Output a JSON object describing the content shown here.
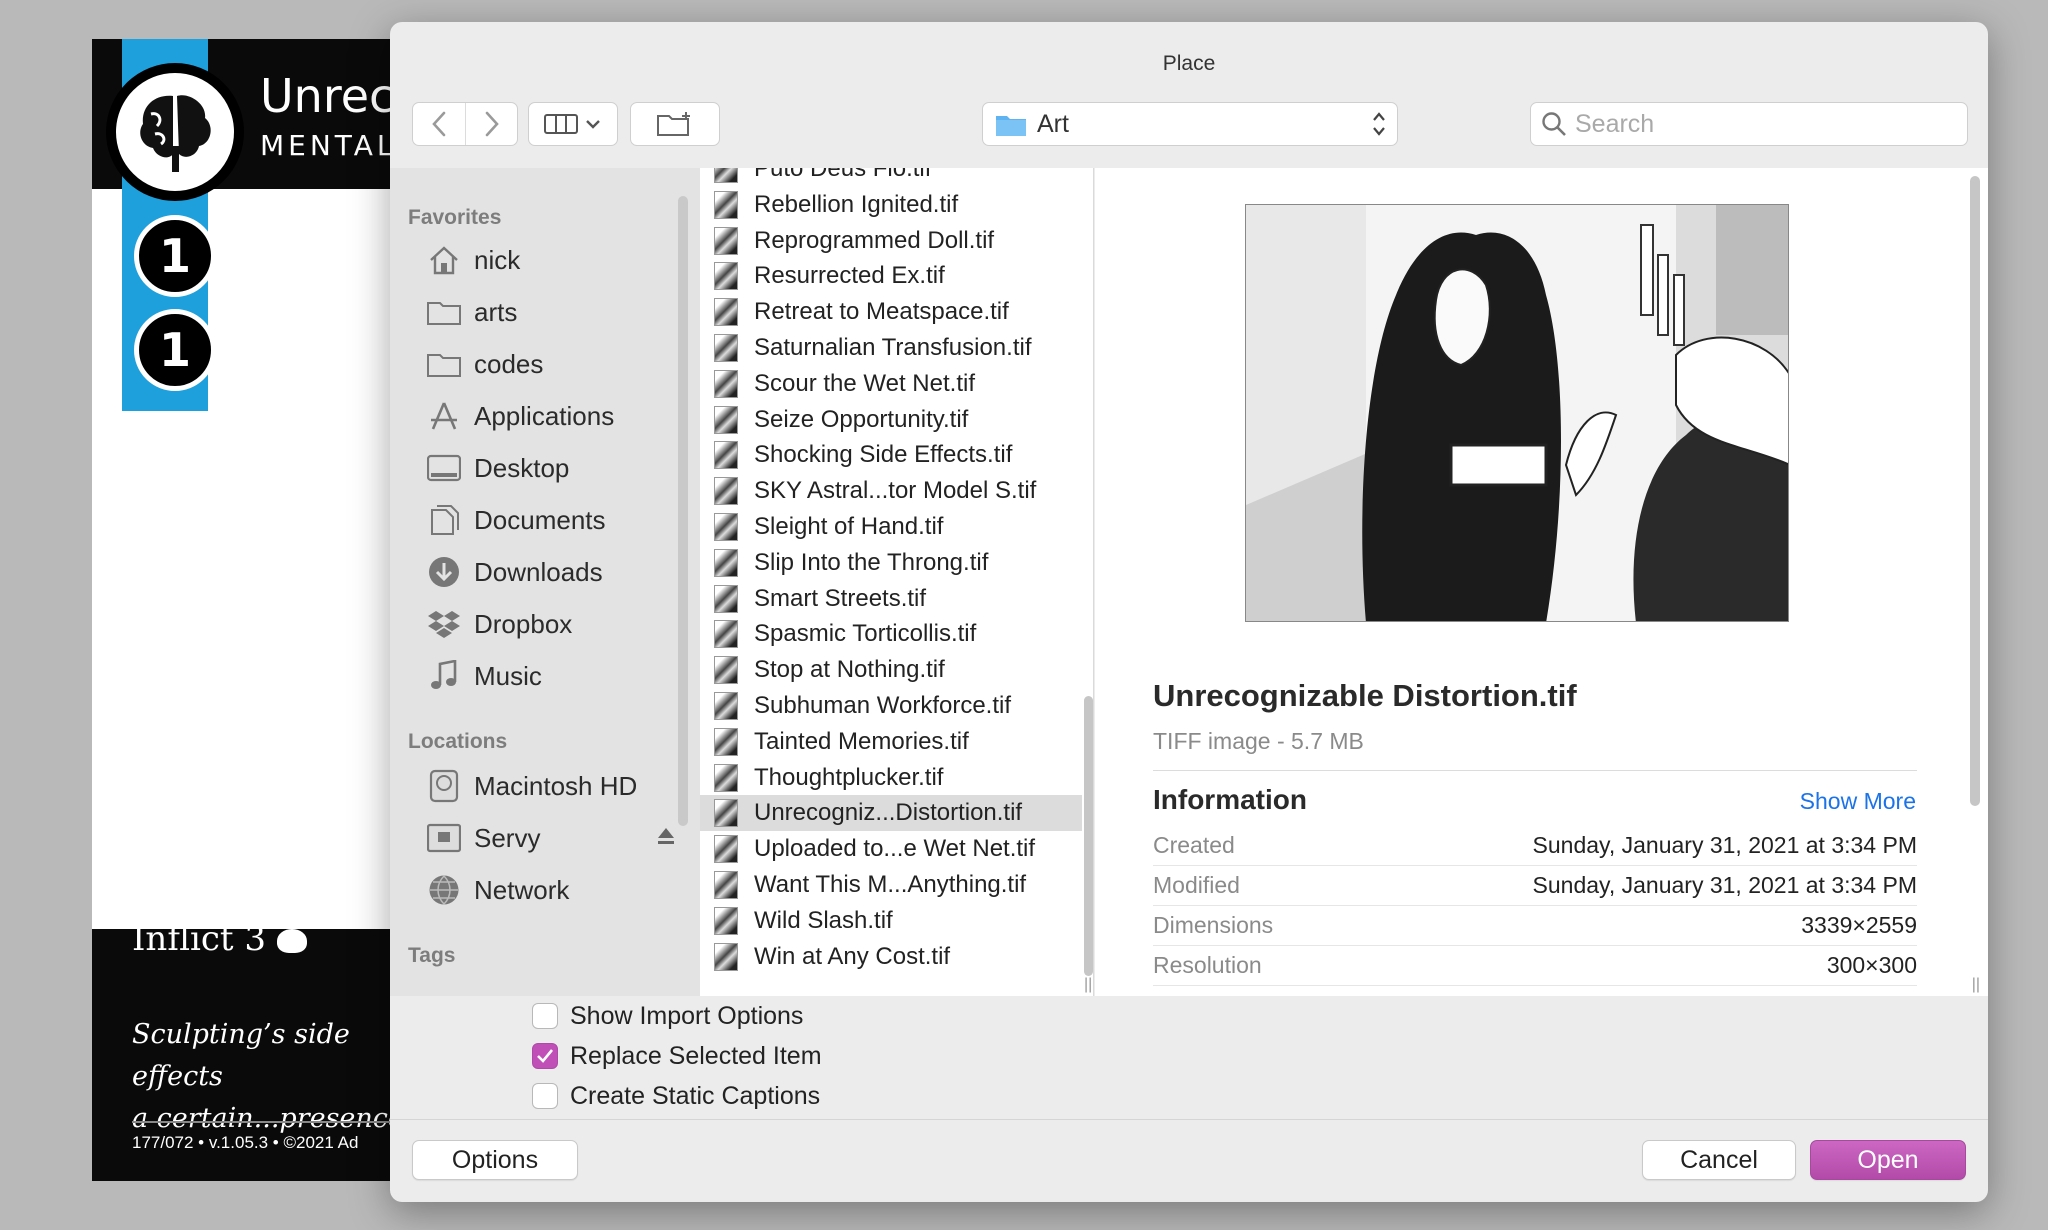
{
  "background_card": {
    "title": "Unreco",
    "subtitle": "MENTAL",
    "badge_1": "1",
    "badge_2": "1",
    "inflict": "Inflict 3",
    "flavor_line_1": "Sculpting’s side effects",
    "flavor_line_2": "a certain...presence.",
    "footer": "177/072 • v.1.05.3 • ©2021 Ad"
  },
  "dialog": {
    "title": "Place",
    "path_popup": {
      "value": "Art",
      "icon": "folder-icon"
    },
    "search": {
      "placeholder": "Search"
    },
    "toolbar": {
      "back_icon": "chevron-left-icon",
      "forward_icon": "chevron-right-icon",
      "view_icon": "column-view-icon",
      "new_folder_icon": "new-folder-icon"
    }
  },
  "sidebar": {
    "favorites_header": "Favorites",
    "favorites": [
      {
        "label": "nick",
        "icon": "home-icon"
      },
      {
        "label": "arts",
        "icon": "folder-icon"
      },
      {
        "label": "codes",
        "icon": "folder-icon"
      },
      {
        "label": "Applications",
        "icon": "applications-icon"
      },
      {
        "label": "Desktop",
        "icon": "desktop-icon"
      },
      {
        "label": "Documents",
        "icon": "documents-icon"
      },
      {
        "label": "Downloads",
        "icon": "downloads-icon"
      },
      {
        "label": "Dropbox",
        "icon": "dropbox-icon"
      },
      {
        "label": "Music",
        "icon": "music-icon"
      }
    ],
    "locations_header": "Locations",
    "locations": [
      {
        "label": "Macintosh HD",
        "icon": "hard-drive-icon"
      },
      {
        "label": "Servy",
        "icon": "server-icon"
      },
      {
        "label": "Network",
        "icon": "network-icon"
      }
    ],
    "tags_header": "Tags"
  },
  "files": [
    "Puto Deus Flo.tif",
    "Rebellion Ignited.tif",
    "Reprogrammed Doll.tif",
    "Resurrected Ex.tif",
    "Retreat to Meatspace.tif",
    "Saturnalian Transfusion.tif",
    "Scour the Wet Net.tif",
    "Seize Opportunity.tif",
    "Shocking Side Effects.tif",
    "SKY Astral...tor Model S.tif",
    "Sleight of Hand.tif",
    "Slip Into the Throng.tif",
    "Smart Streets.tif",
    "Spasmic Torticollis.tif",
    "Stop at Nothing.tif",
    "Subhuman Workforce.tif",
    "Tainted Memories.tif",
    "Thoughtplucker.tif",
    "Unrecogniz...Distortion.tif",
    "Uploaded to...e Wet Net.tif",
    "Want This M...Anything.tif",
    "Wild Slash.tif",
    "Win at Any Cost.tif"
  ],
  "selected_file_index": 18,
  "preview": {
    "name": "Unrecognizable Distortion.tif",
    "kind": "TIFF image - 5.7 MB",
    "info_header": "Information",
    "show_more": "Show More",
    "rows": [
      {
        "key": "Created",
        "value": "Sunday, January 31, 2021 at 3:34 PM"
      },
      {
        "key": "Modified",
        "value": "Sunday, January 31, 2021 at 3:34 PM"
      },
      {
        "key": "Dimensions",
        "value": "3339×2559"
      },
      {
        "key": "Resolution",
        "value": "300×300"
      }
    ]
  },
  "options": [
    {
      "label": "Show Import Options",
      "checked": false
    },
    {
      "label": "Replace Selected Item",
      "checked": true
    },
    {
      "label": "Create Static Captions",
      "checked": false
    }
  ],
  "buttons": {
    "options": "Options",
    "cancel": "Cancel",
    "open": "Open"
  },
  "colors": {
    "accent": "#c04fb8",
    "link": "#1a73e8",
    "card_stripe": "#1ea0dc"
  }
}
